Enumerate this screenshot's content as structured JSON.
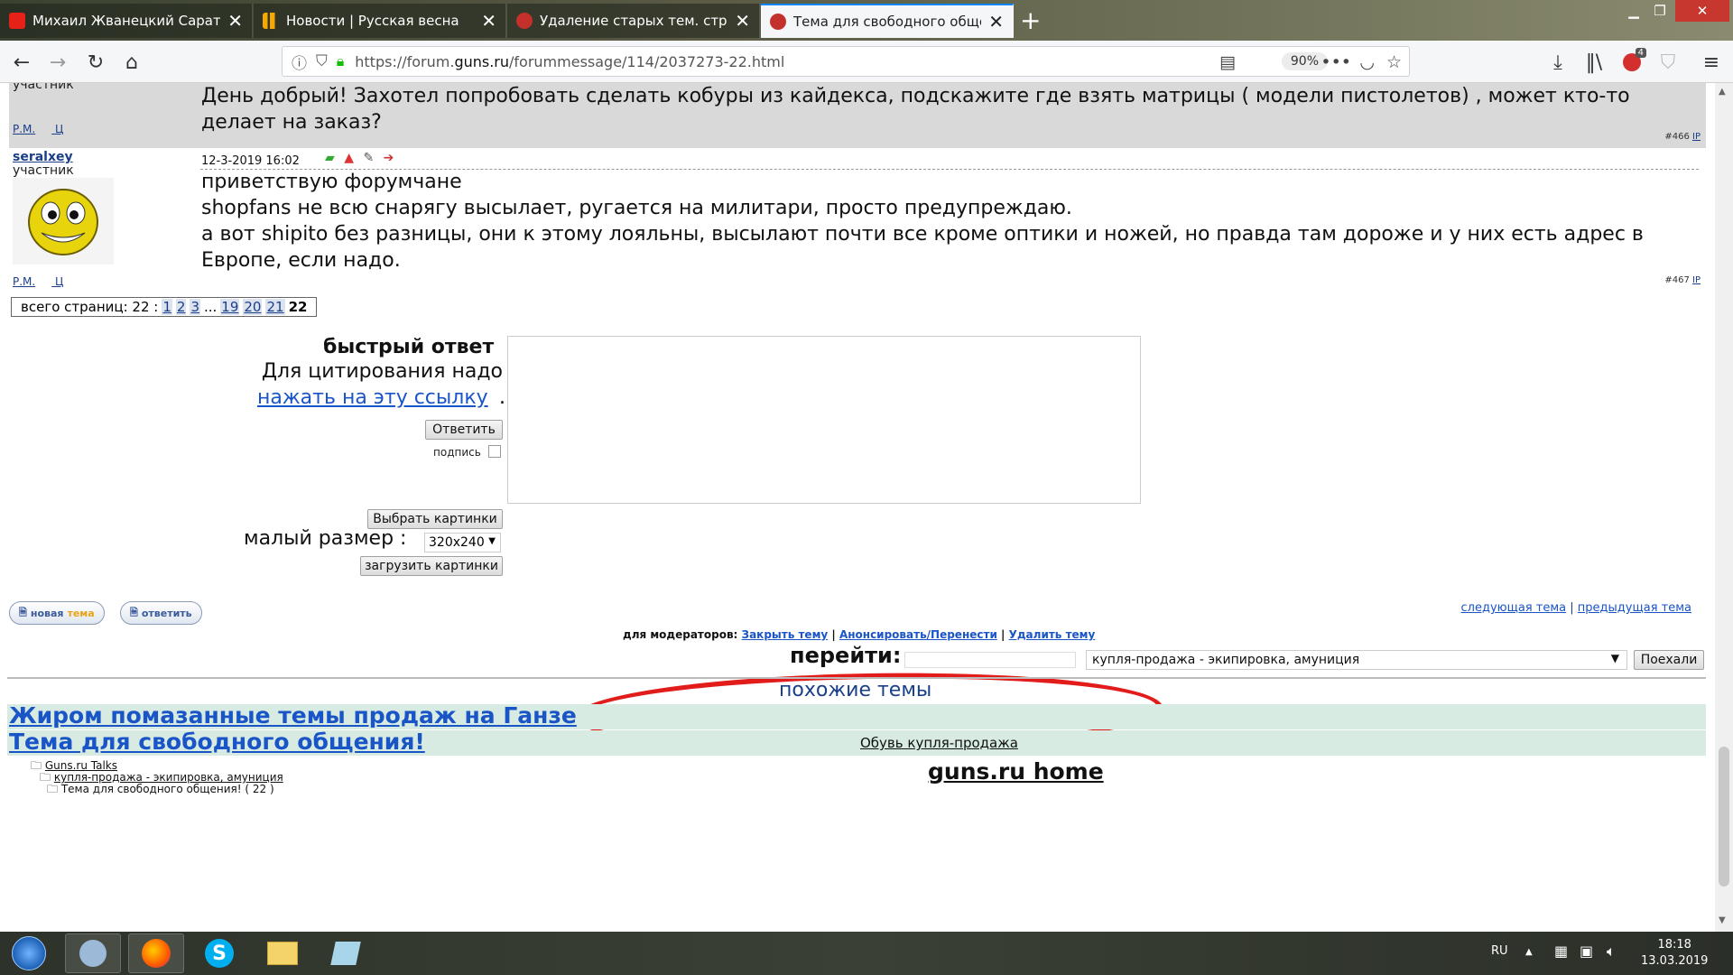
{
  "browser": {
    "tabs": [
      {
        "label": "Михаил Жванецкий Сарат",
        "icon": "youtube-icon",
        "color": "#e62117"
      },
      {
        "label": "Новости | Русская весна",
        "icon": "rusvesna-icon",
        "color": "#f4a900"
      },
      {
        "label": "Удаление старых тем. страни",
        "icon": "forum-icon",
        "color": "#c4302b"
      },
      {
        "label": "Тема для свободного общен",
        "icon": "forum-icon",
        "color": "#c4302b"
      }
    ],
    "url_prefix": "https://forum.",
    "url_domain": "guns.ru",
    "url_path": "/forummessage/114/2037273-22.html",
    "zoom": "90%",
    "badge": "4"
  },
  "posts": [
    {
      "author_role": "участник",
      "text": "День добрый! Захотел попробовать сделать кобуры из кайдекса, подскажите где взять матрицы ( модели пистолетов) , может кто-то делает на заказ?",
      "links": [
        "Р.М.",
        "Ц"
      ],
      "num": "#466",
      "ip": "IP"
    },
    {
      "author": "seralxey",
      "author_role": "участник",
      "date": "12-3-2019 16:02",
      "lines": [
        "приветствую форумчане",
        "shopfans не всю снарягу высылает, ругается на милитари, просто предупреждаю.",
        "а вот shipito без разницы, они к этому лояльны, высылают почти все кроме оптики и ножей, но правда там дороже и у них есть адрес в Европе, если надо."
      ],
      "links": [
        "Р.М.",
        "Ц"
      ],
      "num": "#467",
      "ip": "IP"
    }
  ],
  "pager": {
    "label": "всего страниц: 22 :",
    "pages": [
      "1",
      "2",
      "3",
      "...",
      "19",
      "20",
      "21"
    ],
    "current": "22"
  },
  "quick_reply": {
    "title": "быстрый ответ",
    "cite_text": "Для цитирования надо",
    "cite_link": "нажать на эту ссылку",
    "dot": ".",
    "reply_button": "Ответить",
    "signature_label": "подпись",
    "choose_images": "Выбрать картинки",
    "small_size_label": "малый размер :",
    "small_size_value": "320x240",
    "upload_images": "загрузить картинки"
  },
  "actions": {
    "new_topic_a": "новая",
    "new_topic_b": "тема",
    "reply": "ответить",
    "next_topic": "следующая тема",
    "sep": "|",
    "prev_topic": "предыдущая тема"
  },
  "moderators": {
    "label": "для модераторов:",
    "close": "Закрыть тему",
    "announce": "Анонсировать/Перенести",
    "delete": "Удалить тему"
  },
  "goto": {
    "label": "перейти:",
    "select_value": "купля-продажа - экипировка, амуниция",
    "button": "Поехали"
  },
  "similar": {
    "title": "похожие темы",
    "topic1": "Жиром помазанные темы продаж на Ганзе",
    "topic2": "Тема для свободного общения!",
    "topic3": "Обувь купля-продажа"
  },
  "tree": {
    "root": "Guns.ru Talks",
    "forum": "купля-продажа - экипировка, амуниция",
    "topic": "Тема для свободного общения! ( 22 )"
  },
  "home": "guns.ru home",
  "taskbar": {
    "lang": "RU",
    "time": "18:18",
    "date": "13.03.2019"
  },
  "colors": {
    "link": "#1a55c8",
    "highlight_ellipse": "#e21b1b",
    "post_bg": "#d9d9d9",
    "similar_bg": "#d7ebe3"
  }
}
